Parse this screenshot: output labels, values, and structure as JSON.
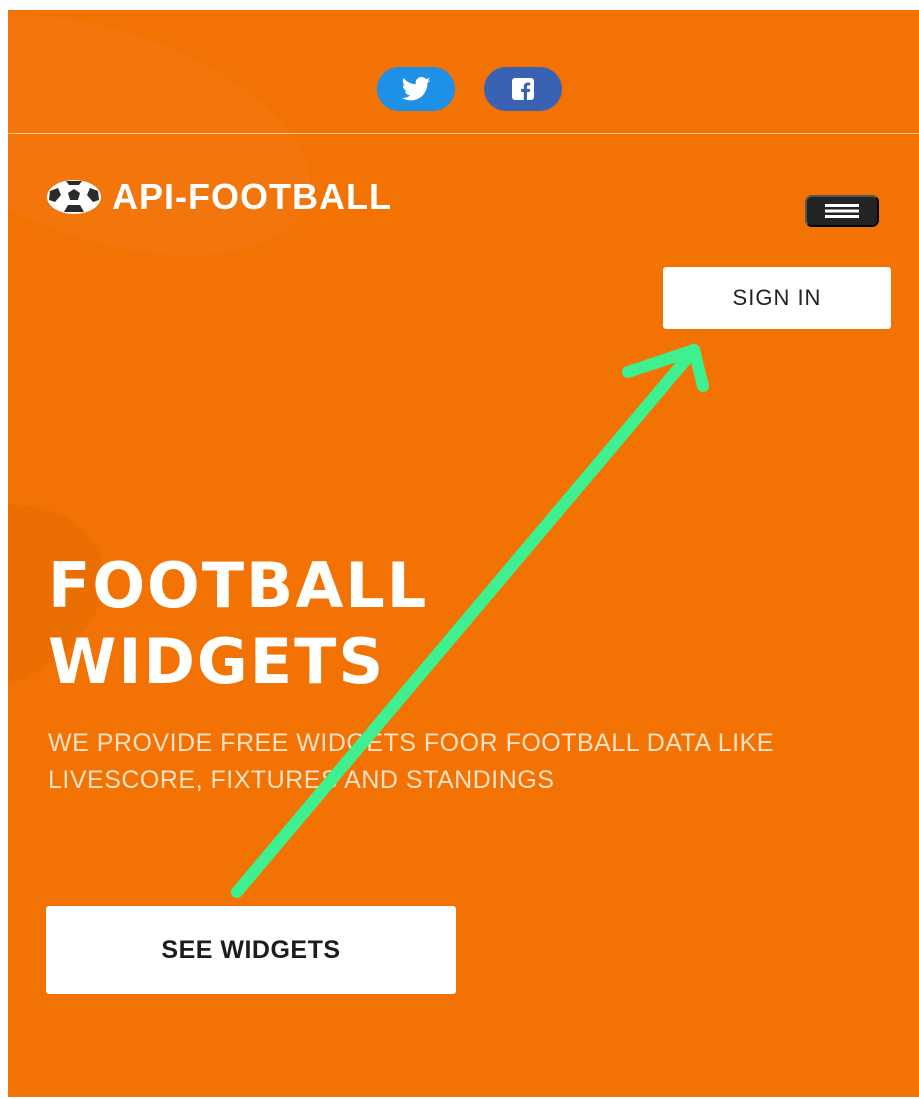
{
  "social": {
    "twitter_icon": "twitter-icon",
    "facebook_icon": "facebook-icon",
    "twitter_color": "#1e90e6",
    "facebook_color": "#3b62b2"
  },
  "header": {
    "logo_text": "API-FOOTBALL",
    "logo_icon": "soccer-ball-icon",
    "menu_icon": "hamburger-menu-icon",
    "signin_label": "SIGN IN"
  },
  "hero": {
    "title_line1": "FOOTBALL",
    "title_line2": "WIDGETS",
    "subtitle": "WE PROVIDE FREE WIDGETS FOOR FOOTBALL DATA LIKE LIVESCORE, FIXTURES AND STANDINGS",
    "cta_label": "SEE WIDGETS"
  },
  "annotation": {
    "type": "arrow",
    "color": "#3ef08f",
    "from": "see-widgets-button",
    "to": "sign-in-button"
  },
  "colors": {
    "background": "#f37204",
    "accent": "#ffffff",
    "menu_button": "#232323"
  }
}
